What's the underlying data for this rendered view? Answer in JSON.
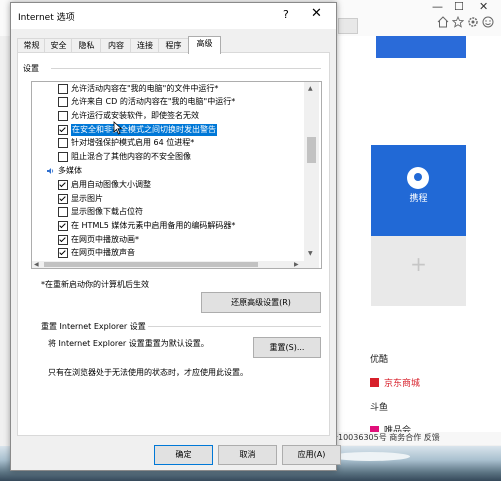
{
  "dialog": {
    "title": "Internet 选项",
    "help": "?",
    "close": "✕",
    "tabs": [
      "常规",
      "安全",
      "隐私",
      "内容",
      "连接",
      "程序",
      "高级"
    ],
    "active_tab": "高级",
    "settings_label": "设置",
    "settings_items": [
      {
        "text": "允许活动内容在\"我的电脑\"的文件中运行*",
        "checked": false,
        "type": "checkbox"
      },
      {
        "text": "允许来自 CD 的活动内容在\"我的电脑\"中运行*",
        "checked": false,
        "type": "checkbox"
      },
      {
        "text": "允许运行或安装软件，即使签名无效",
        "checked": false,
        "type": "checkbox"
      },
      {
        "text": "在安全和非安全模式之间切换时发出警告",
        "checked": true,
        "type": "checkbox",
        "selected": true
      },
      {
        "text": "针对增强保护模式启用 64 位进程*",
        "checked": false,
        "type": "checkbox"
      },
      {
        "text": "阻止混合了其他内容的不安全图像",
        "checked": false,
        "type": "checkbox"
      },
      {
        "text": "多媒体",
        "type": "category"
      },
      {
        "text": "启用自动图像大小调整",
        "checked": true,
        "type": "checkbox"
      },
      {
        "text": "显示图片",
        "checked": true,
        "type": "checkbox"
      },
      {
        "text": "显示图像下载占位符",
        "checked": false,
        "type": "checkbox"
      },
      {
        "text": "在 HTML5 媒体元素中启用备用的编码解码器*",
        "checked": true,
        "type": "checkbox"
      },
      {
        "text": "在网页中播放动画*",
        "checked": true,
        "type": "checkbox"
      },
      {
        "text": "在网页中播放声音",
        "checked": true,
        "type": "checkbox"
      }
    ],
    "restart_note": "*在重新启动你的计算机后生效",
    "restore_button": "还原高级设置(R)",
    "reset_section_title": "重置 Internet Explorer 设置",
    "reset_description": "将 Internet Explorer 设置重置为默认设置。",
    "reset_button": "重置(S)...",
    "reset_note": "只有在浏览器处于无法使用的状态时，才应使用此设置。",
    "ok": "确定",
    "cancel": "取消",
    "apply": "应用(A)"
  },
  "background": {
    "window_controls": [
      "—",
      "☐",
      "✕"
    ],
    "toolbar_icons": [
      "home-icon",
      "favorites-icon",
      "settings-icon",
      "smiley-icon"
    ],
    "tile_label": "携程",
    "add_tile": "+",
    "links": [
      "优酷",
      "京东商城",
      "斗鱼",
      "唯品会"
    ],
    "footer": "备10036305号   商务合作   反馈"
  },
  "colors": {
    "accent": "#0078d7",
    "tile_blue": "#2169d6",
    "jd_red": "#d71f2a"
  }
}
